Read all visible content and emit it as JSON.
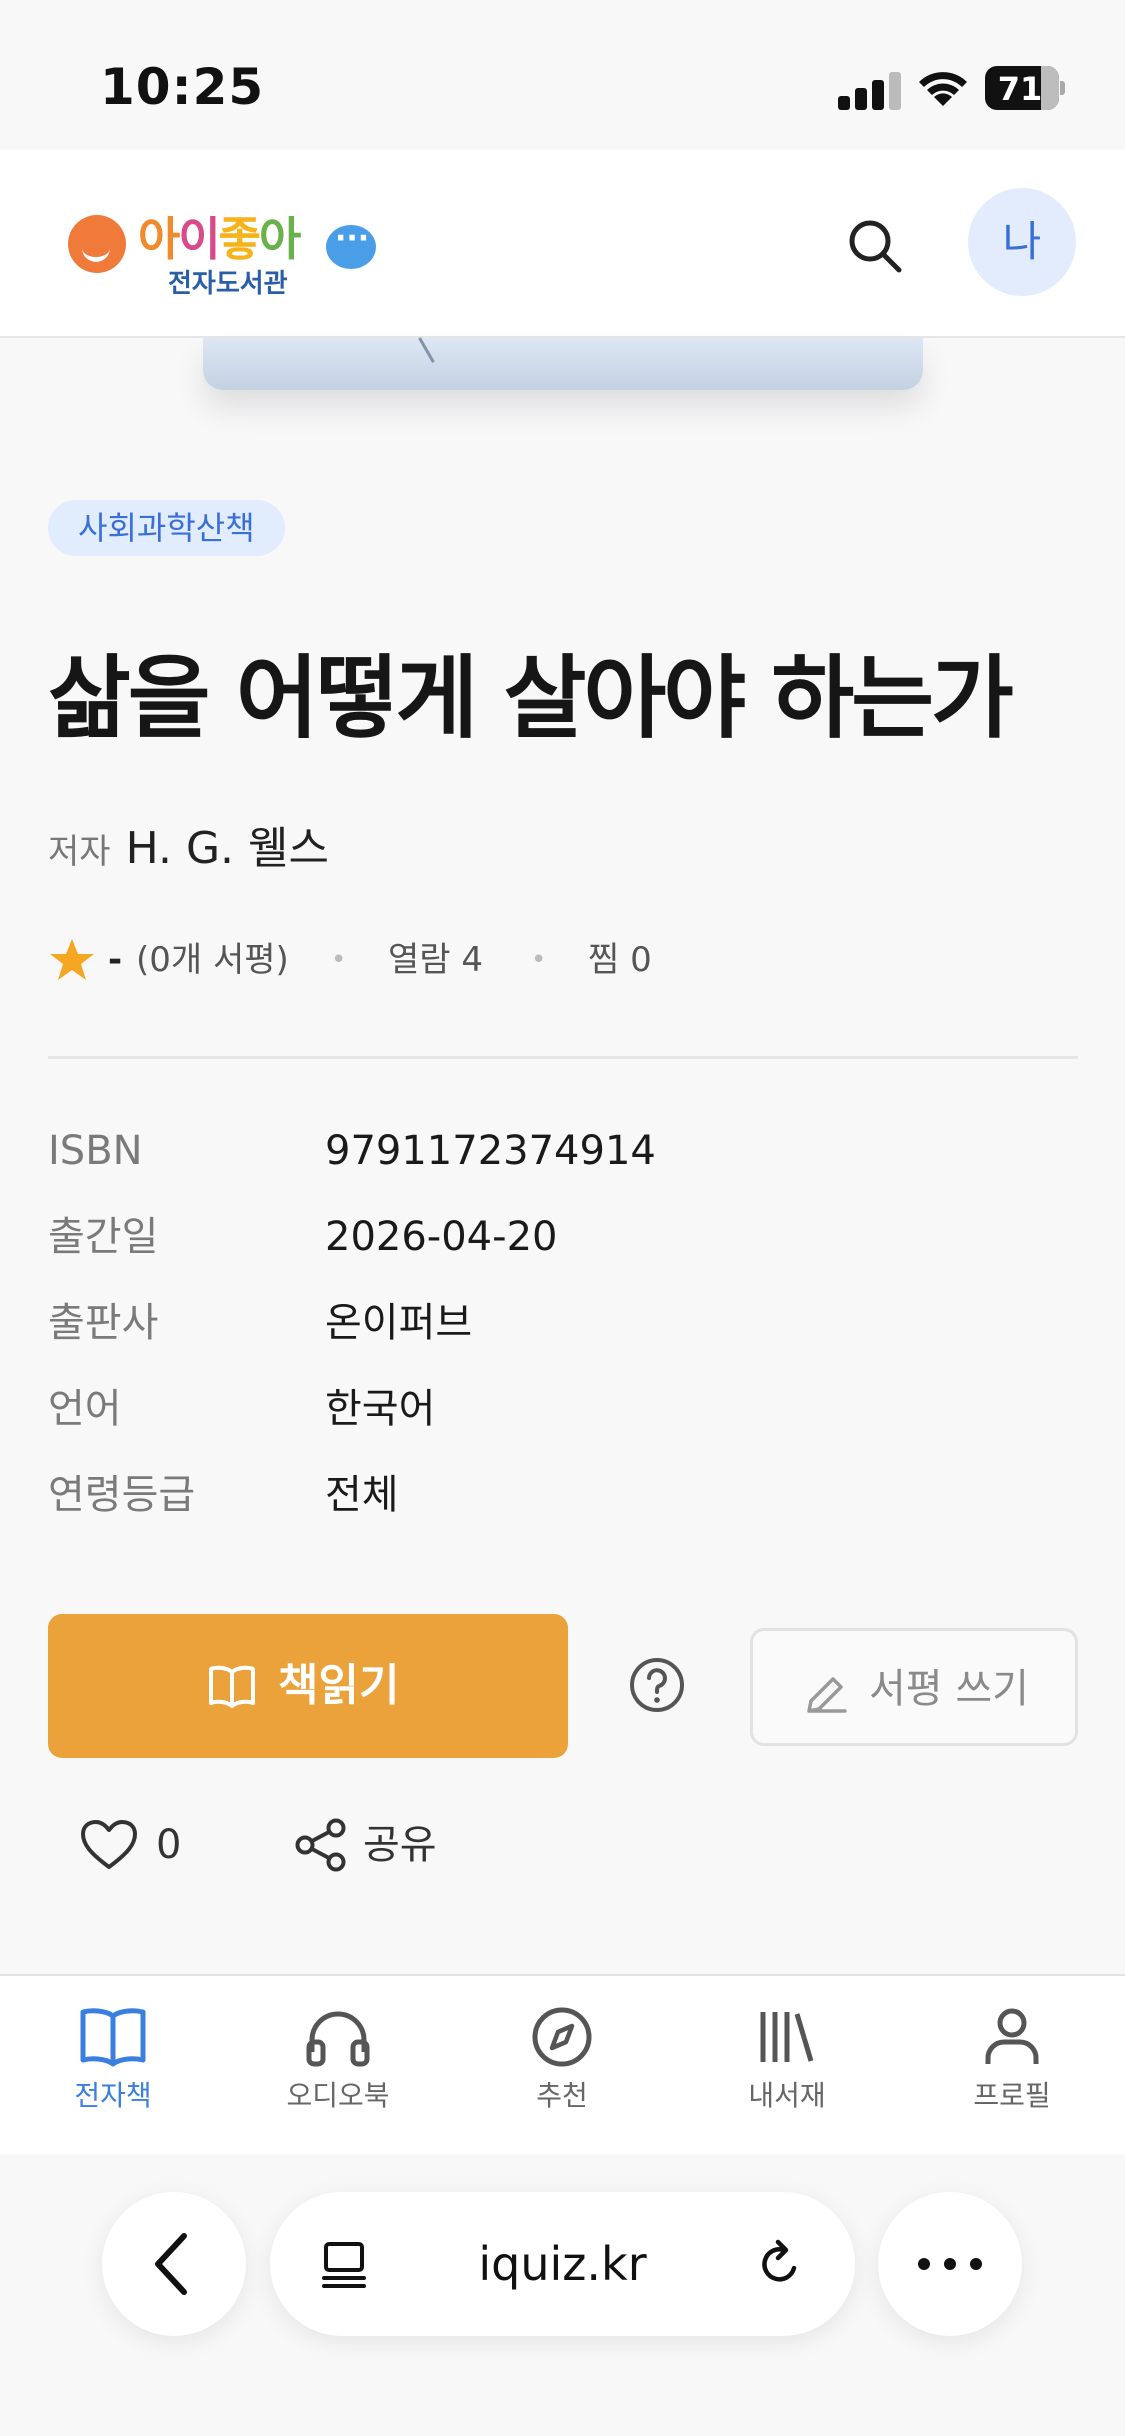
{
  "status_bar": {
    "time": "10:25",
    "battery": "71"
  },
  "header": {
    "logo_title": [
      "아",
      "이",
      "좋",
      "아"
    ],
    "logo_subtitle": "전자도서관",
    "avatar_label": "나"
  },
  "book": {
    "category": "사회과학산책",
    "title": "삶을 어떻게 살아야 하는가",
    "author_label": "저자",
    "author": "H. G. 웰스",
    "rating": "-",
    "review_count": "(0개 서평)",
    "views": "열람 4",
    "likes_stat": "찜 0"
  },
  "details": [
    {
      "label": "ISBN",
      "value": "9791172374914"
    },
    {
      "label": "출간일",
      "value": "2026-04-20"
    },
    {
      "label": "출판사",
      "value": "온이퍼브"
    },
    {
      "label": "언어",
      "value": "한국어"
    },
    {
      "label": "연령등급",
      "value": "전체"
    }
  ],
  "actions": {
    "read_label": "책읽기",
    "review_label": "서평 쓰기",
    "like_count": "0",
    "share_label": "공유"
  },
  "tabs": [
    {
      "label": "전자책",
      "icon": "open-book-icon",
      "active": true
    },
    {
      "label": "오디오북",
      "icon": "headphones-icon",
      "active": false
    },
    {
      "label": "추천",
      "icon": "compass-icon",
      "active": false
    },
    {
      "label": "내서재",
      "icon": "library-icon",
      "active": false
    },
    {
      "label": "프로필",
      "icon": "person-icon",
      "active": false
    }
  ],
  "browser": {
    "url": "iquiz.kr"
  },
  "colors": {
    "accent": "#3a7ee0",
    "read_button": "#eba23a",
    "category_bg": "#e1ecfc",
    "star": "#f5a623"
  }
}
